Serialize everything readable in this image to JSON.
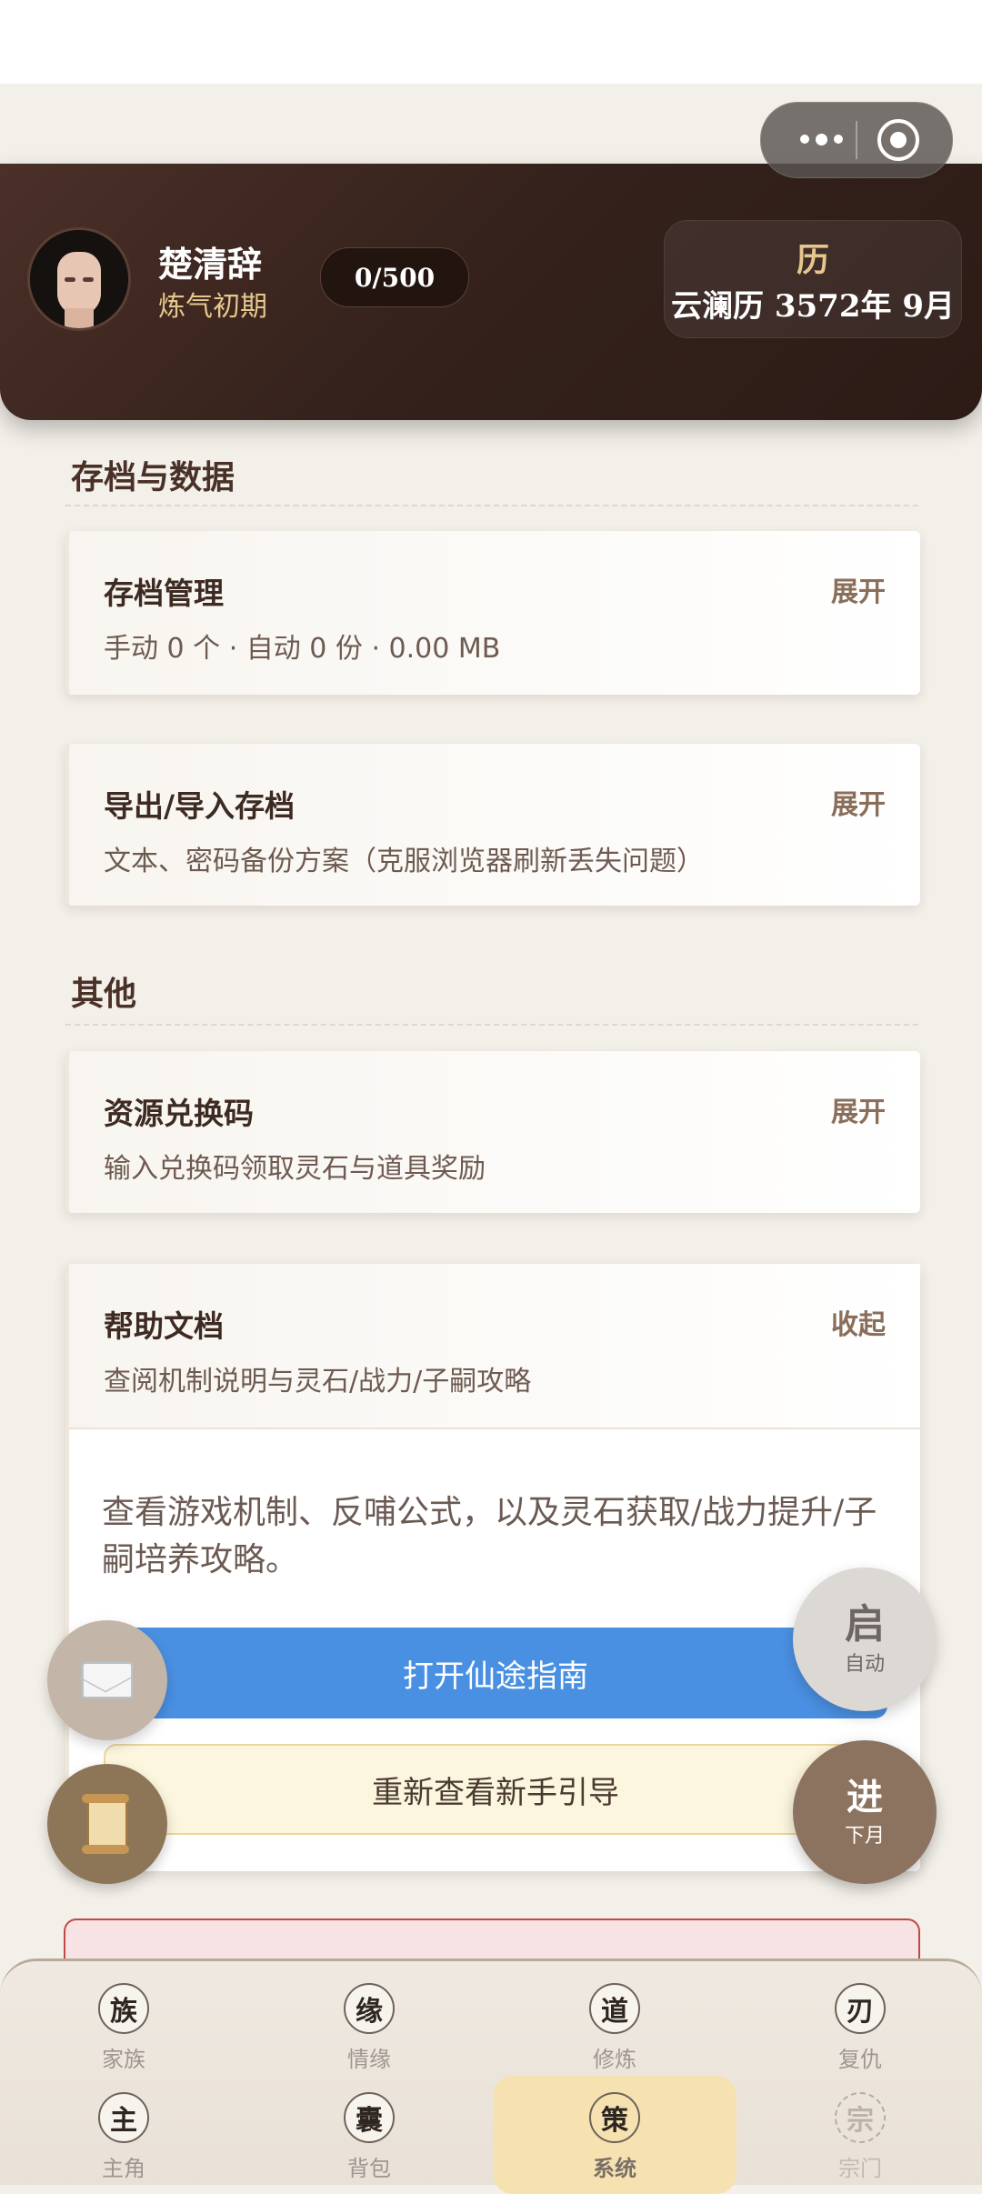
{
  "window": {
    "more_icon": "more-dots-icon",
    "close_icon": "target-close-icon"
  },
  "profile": {
    "name": "楚清辞",
    "realm": "炼气初期",
    "counter": "0/500",
    "calendar_icon": "历",
    "calendar_date": "云澜历 3572年 9月"
  },
  "sections": {
    "save": {
      "title": "存档与数据",
      "cards": [
        {
          "title": "存档管理",
          "desc": "手动 0 个 · 自动 0 份 · 0.00 MB",
          "action": "展开"
        },
        {
          "title": "导出/导入存档",
          "desc": "文本、密码备份方案（克服浏览器刷新丢失问题）",
          "action": "展开"
        }
      ]
    },
    "other": {
      "title": "其他",
      "cards": [
        {
          "title": "资源兑换码",
          "desc": "输入兑换码领取灵石与道具奖励",
          "action": "展开"
        }
      ]
    },
    "help": {
      "title": "帮助文档",
      "desc": "查阅机制说明与灵石/战力/子嗣攻略",
      "action": "收起",
      "body": "查看游戏机制、反哺公式，以及灵石获取/战力提升/子嗣培养攻略。",
      "guide_button": "打开仙途指南",
      "tutorial_button": "重新查看新手引导"
    }
  },
  "fabs": {
    "mail_icon": "envelope-icon",
    "scroll_icon": "scroll-icon",
    "auto": {
      "big": "启",
      "small": "自动"
    },
    "next": {
      "big": "进",
      "small": "下月"
    }
  },
  "nav": {
    "row1": [
      {
        "glyph": "族",
        "label": "家族"
      },
      {
        "glyph": "缘",
        "label": "情缘"
      },
      {
        "glyph": "道",
        "label": "修炼"
      },
      {
        "glyph": "刃",
        "label": "复仇"
      }
    ],
    "row2": [
      {
        "glyph": "主",
        "label": "主角"
      },
      {
        "glyph": "囊",
        "label": "背包"
      },
      {
        "glyph": "策",
        "label": "系统",
        "active": true
      },
      {
        "glyph": "宗",
        "label": "宗门",
        "disabled": true
      }
    ]
  },
  "colors": {
    "header_bg": "#34211b",
    "gold": "#e5c78d",
    "primary_button": "#4a90e2",
    "active_tab": "#f5e2b0"
  }
}
